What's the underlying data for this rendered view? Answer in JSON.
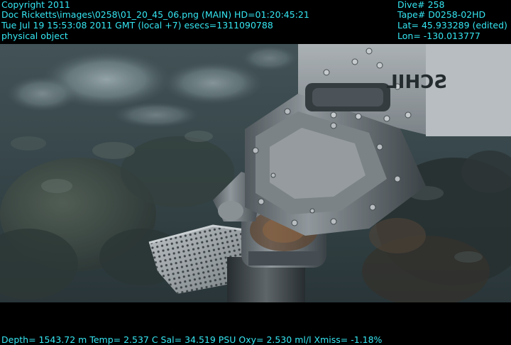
{
  "overlay": {
    "top_left": {
      "copyright": "Copyright 2011",
      "file": "Doc Ricketts\\images\\0258\\01_20_45_06.png (MAIN)  HD=01:20:45:21",
      "datetime": "Tue Jul 19 15:53:08 2011 GMT (local +7)  esecs=1311090788",
      "classification": "physical object"
    },
    "top_right": {
      "dive": "Dive# 258",
      "tape": "Tape# D0258-02HD",
      "lat": "Lat= 45.933289 (edited)",
      "lon": "Lon= -130.013777"
    },
    "bottom": {
      "telemetry": "Depth= 1543.72 m  Temp= 2.537 C  Sal= 34.519 PSU  Oxy= 2.530 ml/l  Xmiss= -1.18%"
    },
    "text_color": "#35e6f2"
  },
  "scene": {
    "arm_label": "SCHIL"
  }
}
